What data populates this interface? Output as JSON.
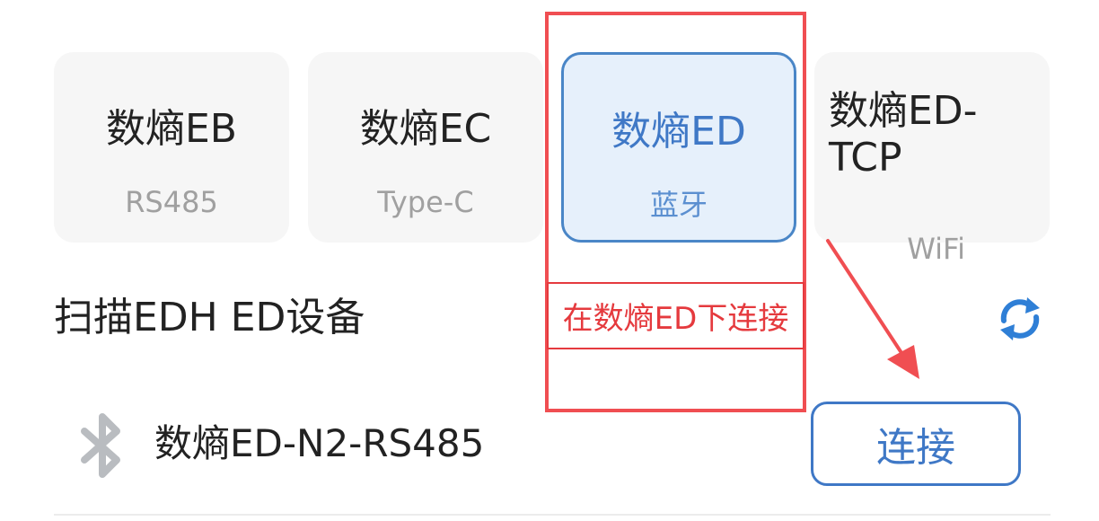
{
  "device_types": [
    {
      "name": "数熵EB",
      "sub": "RS485",
      "selected": false
    },
    {
      "name": "数熵EC",
      "sub": "Type-C",
      "selected": false
    },
    {
      "name": "数熵ED",
      "sub": "蓝牙",
      "selected": true
    },
    {
      "name": "数熵ED-TCP",
      "sub": "WiFi",
      "selected": false
    }
  ],
  "scan": {
    "title": "扫描EDH ED设备",
    "refresh_icon": "refresh-icon"
  },
  "annotation": {
    "label": "在数熵ED下连接",
    "color": "#e53a3e"
  },
  "devices": [
    {
      "icon": "bluetooth-icon",
      "name": "数熵ED-N2-RS485",
      "action_label": "连接"
    }
  ],
  "colors": {
    "accent": "#3f78c6",
    "selected_bg": "#e6f0fb",
    "card_bg": "#f6f6f6",
    "annotation": "#f04e52"
  }
}
